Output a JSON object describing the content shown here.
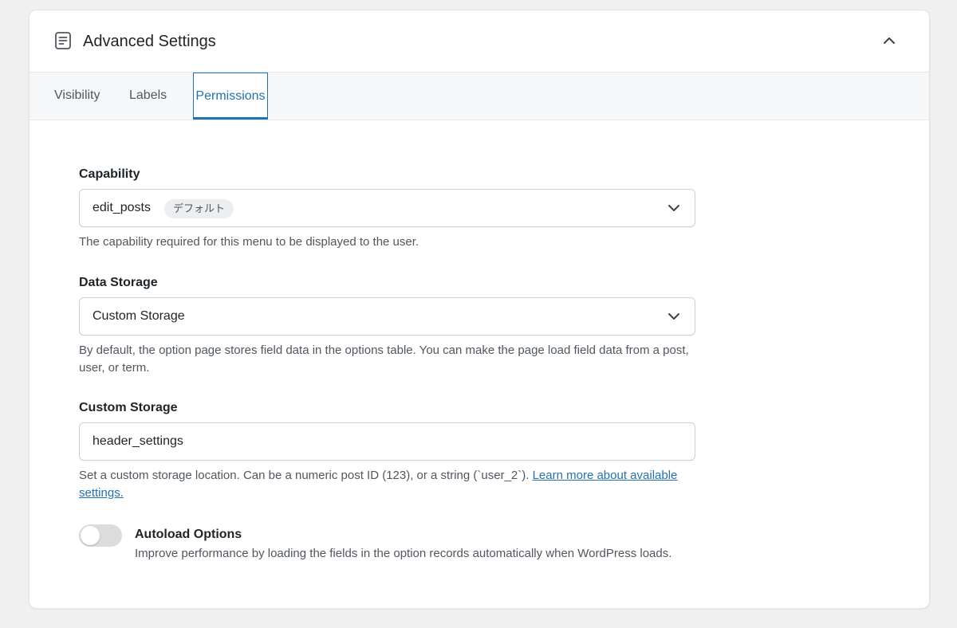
{
  "header": {
    "title": "Advanced Settings"
  },
  "tabs": [
    {
      "label": "Visibility",
      "active": false
    },
    {
      "label": "Labels",
      "active": false
    },
    {
      "label": "Permissions",
      "active": true
    }
  ],
  "capability": {
    "label": "Capability",
    "value": "edit_posts",
    "badge": "デフォルト",
    "help": "The capability required for this menu to be displayed to the user."
  },
  "data_storage": {
    "label": "Data Storage",
    "value": "Custom Storage",
    "help": "By default, the option page stores field data in the options table. You can make the page load field data from a post, user, or term."
  },
  "custom_storage": {
    "label": "Custom Storage",
    "value": "header_settings",
    "help": "Set a custom storage location. Can be a numeric post ID (123), or a string (`user_2`). ",
    "help_link": "Learn more about available settings."
  },
  "autoload": {
    "title": "Autoload Options",
    "description": "Improve performance by loading the fields in the option records automatically when WordPress loads.",
    "enabled": false
  },
  "colors": {
    "accent": "#2271b1",
    "highlight": "#13969a",
    "toggle_off": "#dcdcde"
  }
}
